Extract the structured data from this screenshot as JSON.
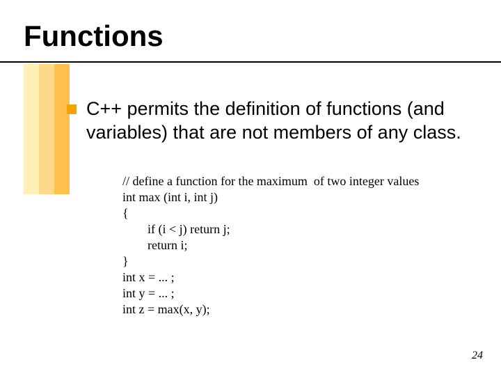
{
  "title": "Functions",
  "body": "C++ permits the definition of functions (and variables) that are not members of any class.",
  "code": "// define a function for the maximum  of two integer values\nint max (int i, int j)\n{\n        if (i < j) return j;\n        return i;\n}\nint x = ... ;\nint y = ... ;\nint z = max(x, y);",
  "page": "24"
}
